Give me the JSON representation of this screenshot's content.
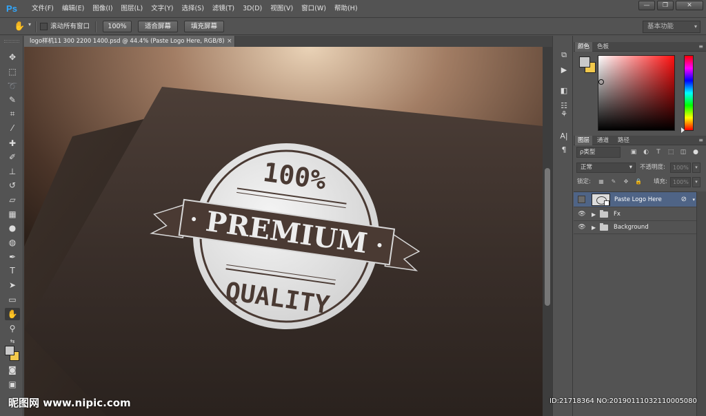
{
  "app": {
    "logo": "Ps"
  },
  "menu": {
    "items": [
      "文件(F)",
      "编辑(E)",
      "图像(I)",
      "图层(L)",
      "文字(Y)",
      "选择(S)",
      "滤镜(T)",
      "3D(D)",
      "视图(V)",
      "窗口(W)",
      "帮助(H)"
    ]
  },
  "window_controls": {
    "minimize": "—",
    "restore": "❐",
    "close": "✕"
  },
  "options_bar": {
    "scroll_all_windows": "滚动所有窗口",
    "zoom_100": "100%",
    "fit_screen": "适合屏幕",
    "fill_screen": "填充屏幕",
    "workspace": "基本功能"
  },
  "document": {
    "tab_title": "logo样机11 300 2200 1400.psd @ 44.4% (Paste Logo Here, RGB/8)",
    "tab_close": "×",
    "badge": {
      "top_text": "100%",
      "ribbon_text": "PREMIUM",
      "bottom_text": "QUALITY"
    }
  },
  "panels": {
    "color_tabs": [
      "颜色",
      "色板"
    ],
    "colors": {
      "foreground": "#c9c9c9",
      "background": "#f2c94c"
    },
    "layer_tabs": [
      "图层",
      "通道",
      "路径"
    ],
    "kind_filter": "ρ类型",
    "blend_mode": "正常",
    "opacity_label": "不透明度:",
    "opacity_value": "100%",
    "lock_label": "锁定:",
    "fill_label": "填充:",
    "fill_value": "100%",
    "layers": [
      {
        "name": "Paste Logo Here",
        "selected": true,
        "visible": false
      },
      {
        "name": "Fx",
        "selected": false,
        "visible": true
      },
      {
        "name": "Background",
        "selected": false,
        "visible": true
      }
    ]
  },
  "watermark": {
    "left": "昵图网 www.nipic.com",
    "right": "ID:21718364 NO:20190111032110005080"
  }
}
